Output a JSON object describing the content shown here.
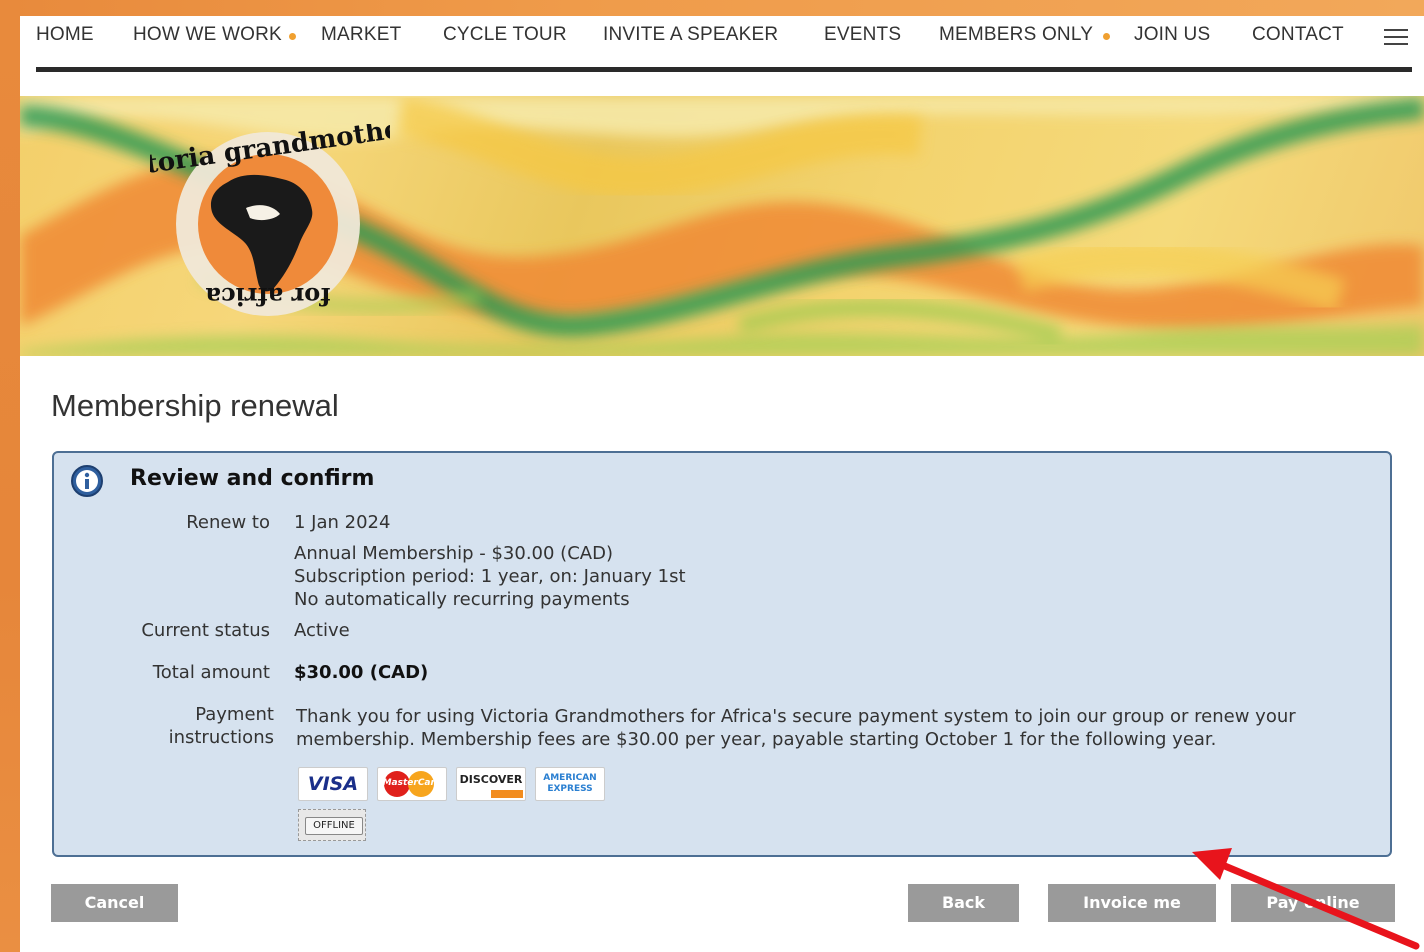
{
  "nav": {
    "items": [
      "HOME",
      "HOW WE WORK",
      "MARKET",
      "CYCLE TOUR",
      "INVITE A SPEAKER",
      "EVENTS",
      "MEMBERS ONLY",
      "JOIN US",
      "CONTACT"
    ]
  },
  "banner": {
    "logo_text_top": "victoria grandmothers",
    "logo_text_bottom": "for africa"
  },
  "page": {
    "title": "Membership renewal"
  },
  "panel": {
    "title": "Review and confirm",
    "renew_label": "Renew to",
    "renew_value": "1 Jan 2024",
    "membership_line": "Annual Membership - $30.00 (CAD)",
    "subscription_line": "Subscription period: 1 year, on: January 1st",
    "recurring_line": "No automatically recurring payments",
    "status_label": "Current status",
    "status_value": "Active",
    "total_label": "Total amount",
    "total_value": "$30.00 (CAD)",
    "instructions_label_1": "Payment",
    "instructions_label_2": "instructions",
    "instructions_text": "Thank you for using Victoria Grandmothers for Africa's secure payment system to join our group or renew your membership. Membership fees are $30.00 per year, payable starting October 1 for the following year."
  },
  "cards": {
    "visa": "VISA",
    "mastercard": "MasterCard",
    "discover": "DISCOVER",
    "amex_1": "AMERICAN",
    "amex_2": "EXPRESS",
    "offline": "OFFLINE"
  },
  "buttons": {
    "cancel": "Cancel",
    "back": "Back",
    "invoice": "Invoice me",
    "pay": "Pay online"
  },
  "colors": {
    "accent_orange": "#e88a3c",
    "panel_bg": "#d6e2ef",
    "panel_border": "#4d6f94",
    "button_gray": "#9a9a9a",
    "arrow_red": "#e8141c"
  }
}
